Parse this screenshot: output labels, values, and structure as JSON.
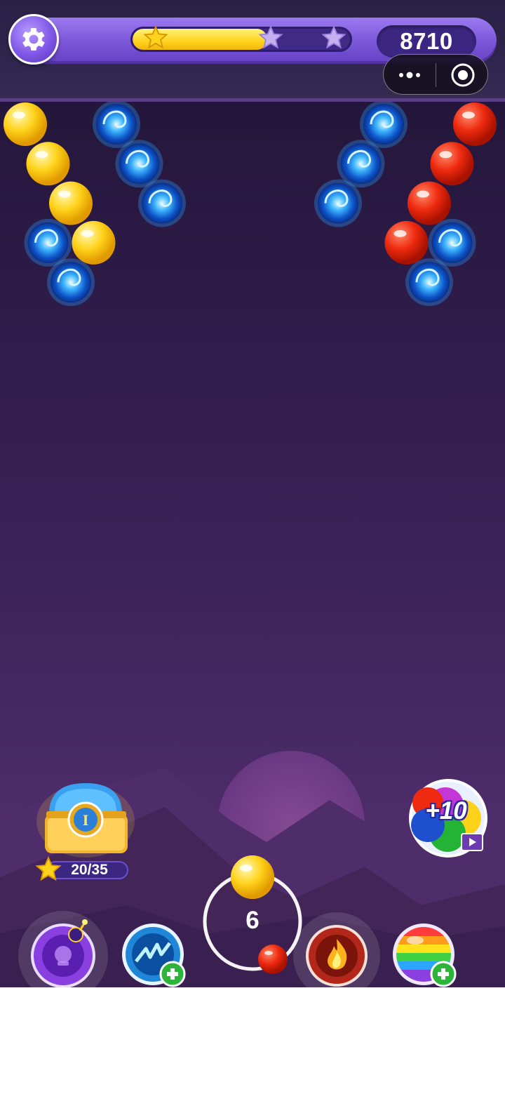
{
  "hud": {
    "score": "8710",
    "progress_fraction": 0.62,
    "stars_earned": 1,
    "stars_total": 3,
    "colors": {
      "bar": "#7a56d8",
      "progress": "#ffd21c",
      "star_earned": "#ffd21c",
      "star_empty": "#b39ae8"
    }
  },
  "mini_program_capsule": {
    "more_icon": "more-dots-icon",
    "close_icon": "target-close-icon"
  },
  "bubbles": [
    {
      "color": "yellow",
      "col": 0,
      "row": 0
    },
    {
      "color": "yellow",
      "col": 1,
      "row": 1
    },
    {
      "color": "yellow",
      "col": 2,
      "row": 2
    },
    {
      "color": "yellow",
      "col": 3,
      "row": 3
    },
    {
      "color": "vortex",
      "col": 4,
      "row": 0
    },
    {
      "color": "vortex",
      "col": 5,
      "row": 1
    },
    {
      "color": "vortex",
      "col": 6,
      "row": 2
    },
    {
      "color": "vortex",
      "col": 1,
      "row": 3
    },
    {
      "color": "vortex",
      "col": 2,
      "row": 4
    },
    {
      "color": "vortex",
      "col": 16,
      "row": 0
    },
    {
      "color": "vortex",
      "col": 15,
      "row": 1
    },
    {
      "color": "vortex",
      "col": 14,
      "row": 2
    },
    {
      "color": "red",
      "col": 20,
      "row": 0
    },
    {
      "color": "red",
      "col": 19,
      "row": 1
    },
    {
      "color": "red",
      "col": 18,
      "row": 2
    },
    {
      "color": "red",
      "col": 17,
      "row": 3
    },
    {
      "color": "vortex",
      "col": 19,
      "row": 3
    },
    {
      "color": "vortex",
      "col": 18,
      "row": 4
    }
  ],
  "chest": {
    "progress": "20/35",
    "label": "I",
    "icon": "treasure-chest-icon"
  },
  "extra_bubbles": {
    "label": "+10",
    "icon": "video-ad-icon"
  },
  "launcher": {
    "shots_left": "6",
    "current_bubble": "yellow",
    "next_bubble": "red"
  },
  "powerups": [
    {
      "name": "bomb-bubble-icon",
      "has_add": false
    },
    {
      "name": "lightning-bubble-icon",
      "has_add": true
    },
    {
      "name": "fire-bubble-icon",
      "has_add": false
    },
    {
      "name": "rainbow-bubble-icon",
      "has_add": true
    }
  ],
  "bubble_colors": {
    "yellow": "#ffd21a",
    "red": "#ee2a10",
    "vortex": "#2a9cff"
  }
}
